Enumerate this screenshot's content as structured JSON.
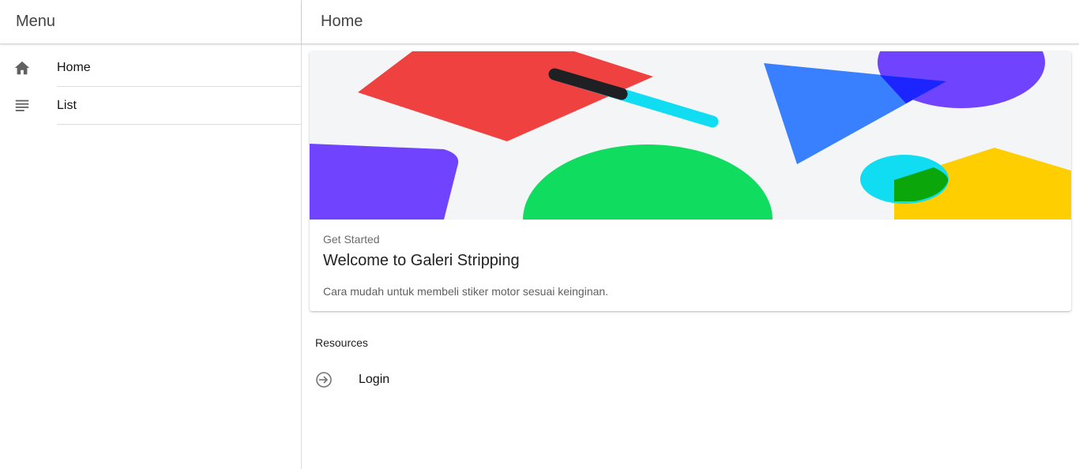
{
  "sidebar": {
    "title": "Menu",
    "items": [
      {
        "label": "Home",
        "icon": "home-icon"
      },
      {
        "label": "List",
        "icon": "list-icon"
      }
    ]
  },
  "header": {
    "title": "Home"
  },
  "card": {
    "subtitle": "Get Started",
    "title": "Welcome to Galeri Stripping",
    "text": "Cara mudah untuk membeli stiker motor sesuai keinginan.",
    "art_colors": {
      "background": "#f4f5f7",
      "red": "#f04141",
      "cyan": "#10dcf2",
      "dark": "#1e2023",
      "blue": "#3880ff",
      "purple": "#7044ff",
      "green": "#10dc60",
      "yellow": "#ffce00"
    }
  },
  "resources": {
    "label": "Resources",
    "items": [
      {
        "label": "Login",
        "icon": "login-icon"
      }
    ]
  }
}
